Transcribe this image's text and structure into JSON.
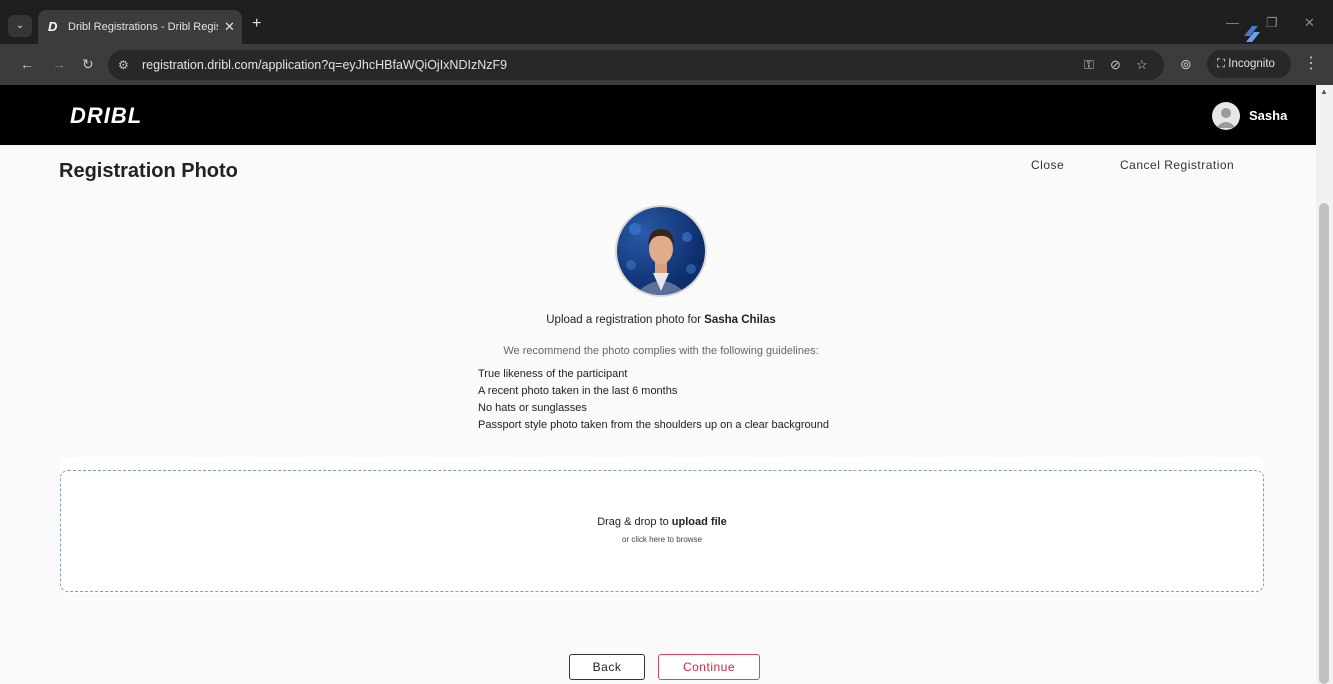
{
  "browser": {
    "tab_title": "Dribl Registrations - Dribl Regis",
    "tab_favicon": "D",
    "tab_close": "✕",
    "new_tab": "+",
    "url": "registration.dribl.com/application?q=eyJhcHBfaWQiOjIxNDIzNzF9",
    "incognito_label": "Incognito",
    "icons": [
      "tab-search-icon",
      "back-icon",
      "forward-icon",
      "reload-icon",
      "site-info-icon",
      "password-key-icon",
      "eye-off-icon",
      "star-icon",
      "extension-icon",
      "incognito-icon",
      "more-icon"
    ]
  },
  "header": {
    "logo": "DRIBL",
    "user_name": "Sasha"
  },
  "page": {
    "title": "Registration Photo",
    "close_label": "Close",
    "cancel_label": "Cancel Registration",
    "upload_prefix": "Upload a registration photo for ",
    "participant_name": "Sasha Chilas",
    "recommend_text": "We recommend the photo complies with the following guidelines:",
    "guidelines": [
      "True likeness of the participant",
      "A recent photo taken in the last 6 months",
      "No hats or sunglasses",
      "Passport style photo taken from the shoulders up on a clear background"
    ],
    "drop_prefix": "Drag & drop to ",
    "drop_bold": "upload file",
    "drop_sub": "or click here to browse",
    "back_label": "Back",
    "continue_label": "Continue"
  },
  "colors": {
    "header_bg": "#000000",
    "continue_accent": "#c8283f",
    "dropzone_border": "#7e9bc4",
    "photo_bg": "#0d2d6b"
  }
}
